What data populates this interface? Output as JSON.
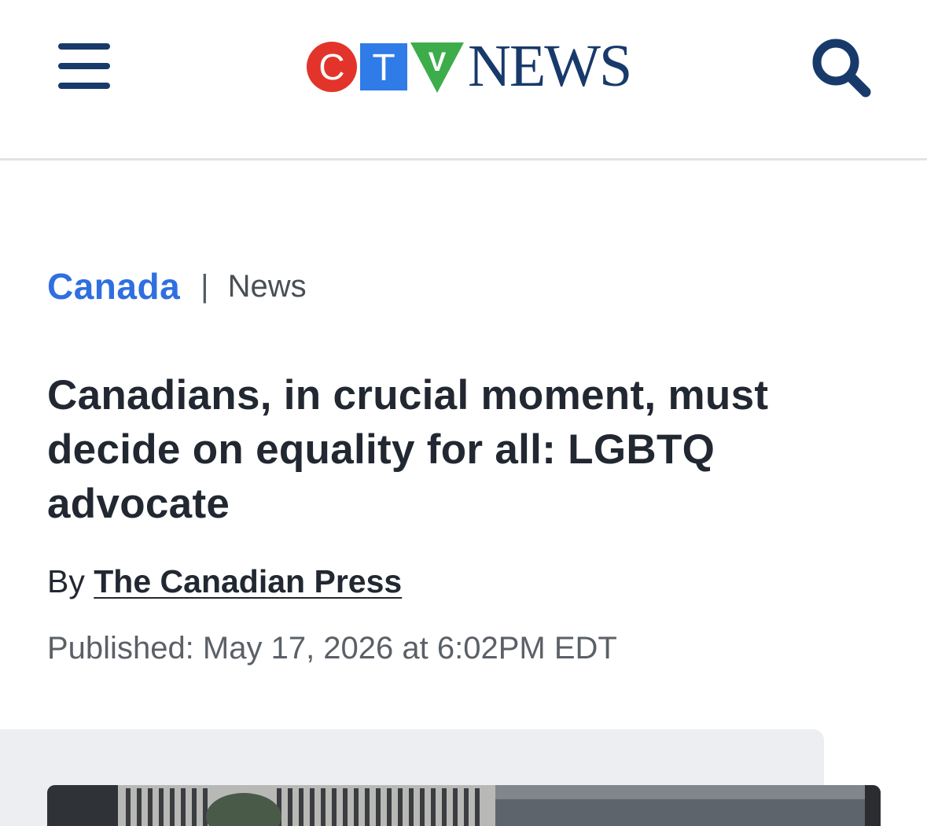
{
  "header": {
    "menu_icon": "hamburger-menu-icon",
    "logo": {
      "letters": [
        "C",
        "T",
        "V"
      ],
      "wordmark": "NEWS",
      "colors": {
        "c": "#e3342b",
        "t": "#2f7be8",
        "v": "#3cad4a",
        "wordmark": "#183a6b"
      }
    },
    "search_icon": "search-icon"
  },
  "breadcrumb": {
    "section": "Canada",
    "separator": "|",
    "type": "News"
  },
  "article": {
    "headline": "Canadians, in crucial moment, must decide on equality for all: LGBTQ advocate",
    "byline_prefix": "By",
    "author": "The Canadian Press",
    "published": "Published: May 17, 2026 at 6:02PM EDT"
  },
  "colors": {
    "accent": "#2f6fe0",
    "navy": "#183a6b",
    "text": "#222831",
    "muted": "#5b6067",
    "panel": "#eceef1"
  }
}
